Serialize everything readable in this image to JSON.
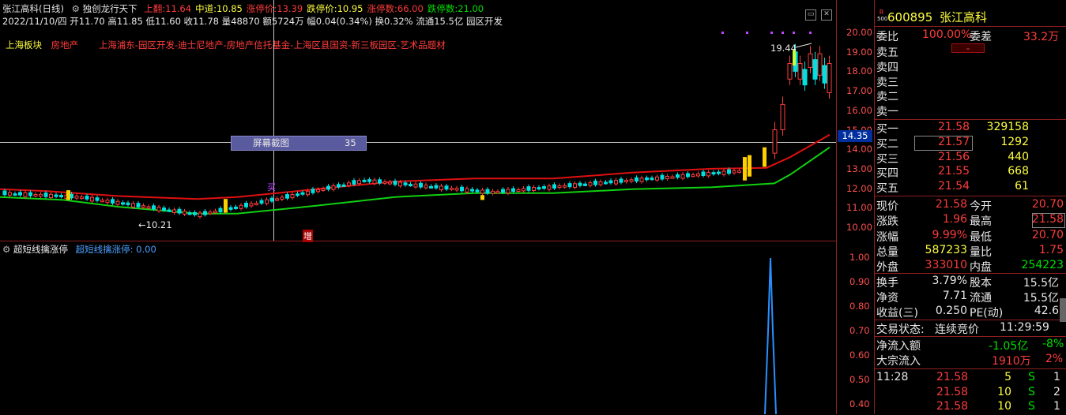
{
  "header": {
    "title": "张江高科(日线)",
    "indicator_name": "独创龙行天下",
    "fields": [
      {
        "label": "上翻:",
        "value": "11.64",
        "color": "#ff3c3c"
      },
      {
        "label": "中道:",
        "value": "10.85",
        "color": "#ffff40"
      },
      {
        "label": "涨停价:",
        "value": "13.39",
        "color": "#ff3c3c"
      },
      {
        "label": "跌停价:",
        "value": "10.95",
        "color": "#ffff40"
      },
      {
        "label": "涨停数:",
        "value": "66.00",
        "color": "#ff3c3c"
      },
      {
        "label": "跌停数:",
        "value": "21.00",
        "color": "#00e000"
      }
    ],
    "info_line": "2022/11/10/四 开11.70 高11.85 低11.60 收11.78 量48870 额5724万 幅0.04(0.34%) 换0.32% 流通15.5亿 园区开发",
    "sector_label": "上海板块",
    "sector_value": "房地产",
    "concepts": "上海浦东-园区开发-迪士尼地产-房地产信托基金-上海区县国资-新三板园区-艺术品题材"
  },
  "main_chart": {
    "price_axis": [
      "20.00",
      "19.00",
      "18.00",
      "17.00",
      "16.00",
      "15.00",
      "14.00",
      "13.00",
      "12.00",
      "11.00",
      "10.00"
    ],
    "crosshair_price": "14.35",
    "screenshot_label": "屏幕截图",
    "screenshot_value": "35",
    "high_marker": "19.44",
    "low_marker": "10.21",
    "increase_marker": "增",
    "purple_marker": "买"
  },
  "sub_chart": {
    "title": "超短线擒涨停",
    "line_label": "超短线擒涨停: 0.00",
    "axis": [
      "1.00",
      "0.90",
      "0.80",
      "0.70",
      "0.60",
      "0.50",
      "0.40"
    ]
  },
  "panel": {
    "code": "600895",
    "name": "张江高科",
    "badge_top": "R",
    "badge_bottom": "500",
    "weibi_label": "委比",
    "weibi_value": "100.00%",
    "weicha_label": "委差",
    "weicha_value": "33.2万",
    "sells": [
      {
        "label": "卖五"
      },
      {
        "label": "卖四"
      },
      {
        "label": "卖三"
      },
      {
        "label": "卖二"
      },
      {
        "label": "卖一"
      }
    ],
    "buys": [
      {
        "label": "买一",
        "price": "21.58",
        "vol": "329158"
      },
      {
        "label": "买二",
        "price": "21.57",
        "vol": "1292"
      },
      {
        "label": "买三",
        "price": "21.56",
        "vol": "440"
      },
      {
        "label": "买四",
        "price": "21.55",
        "vol": "668"
      },
      {
        "label": "买五",
        "price": "21.54",
        "vol": "61"
      }
    ],
    "stats": [
      {
        "l1": "现价",
        "v1": "21.58",
        "c1": "red",
        "l2": "今开",
        "v2": "20.70",
        "c2": "red"
      },
      {
        "l1": "涨跌",
        "v1": "1.96",
        "c1": "red",
        "l2": "最高",
        "v2": "21.58",
        "c2": "red"
      },
      {
        "l1": "涨幅",
        "v1": "9.99%",
        "c1": "red",
        "l2": "最低",
        "v2": "20.70",
        "c2": "red"
      },
      {
        "l1": "总量",
        "v1": "587233",
        "c1": "yellow",
        "l2": "量比",
        "v2": "1.75",
        "c2": "red"
      },
      {
        "l1": "外盘",
        "v1": "333010",
        "c1": "red",
        "l2": "内盘",
        "v2": "254223",
        "c2": "green"
      }
    ],
    "stats2": [
      {
        "l1": "换手",
        "v1": "3.79%",
        "l2": "股本",
        "v2": "15.5亿"
      },
      {
        "l1": "净资",
        "v1": "7.71",
        "l2": "流通",
        "v2": "15.5亿"
      },
      {
        "l1": "收益(三)",
        "v1": "0.250",
        "l2": "PE(动)",
        "v2": "42.6"
      }
    ],
    "trade_status_label": "交易状态:",
    "trade_status_value": "连续竞价",
    "trade_time": "11:29:59",
    "net_inflow_label": "净流入额",
    "net_inflow_value": "-1.05亿",
    "net_inflow_pct": "-8%",
    "block_inflow_label": "大宗流入",
    "block_inflow_value": "1910万",
    "block_inflow_pct": "2%",
    "ticks": [
      {
        "time": "11:28",
        "price": "21.58",
        "vol": "5",
        "side": "S",
        "n": "1"
      },
      {
        "time": "",
        "price": "21.58",
        "vol": "10",
        "side": "S",
        "n": "2"
      },
      {
        "time": "",
        "price": "21.58",
        "vol": "10",
        "side": "S",
        "n": "1"
      }
    ]
  },
  "colors": {
    "up": "#ff3c3c",
    "down": "#00e0e0",
    "ma_upper": "#e01010",
    "ma_lower": "#10d010",
    "yellow": "#ffd000",
    "purple": "#c040ff"
  }
}
